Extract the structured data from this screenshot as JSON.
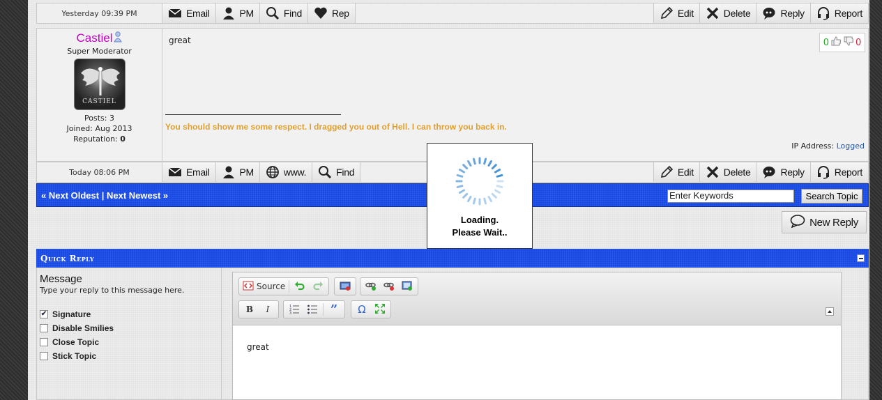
{
  "post1": {
    "date": "Yesterday 09:39 PM",
    "left_buttons": [
      {
        "label": "Email",
        "icon": "envelope-icon"
      },
      {
        "label": "PM",
        "icon": "user-icon"
      },
      {
        "label": "Find",
        "icon": "magnifier-icon"
      },
      {
        "label": "Rep",
        "icon": "heart-icon"
      }
    ],
    "right_buttons": [
      {
        "label": "Edit",
        "icon": "pencil-icon"
      },
      {
        "label": "Delete",
        "icon": "x-icon"
      },
      {
        "label": "Reply",
        "icon": "speech-bubble-icon"
      },
      {
        "label": "Report",
        "icon": "headset-icon"
      }
    ]
  },
  "post2": {
    "author": {
      "name": "Castiel",
      "rank": "Super Moderator",
      "avatar_text": "CASTIEL",
      "posts": "Posts: 3",
      "joined": "Joined: Aug 2013",
      "reputation_label": "Reputation:",
      "reputation_value": "0"
    },
    "message": "great",
    "signature": "You should show me some respect. I dragged you out of Hell. I can throw you back in.",
    "votes_up": "0",
    "votes_down": "0",
    "ip_label": "IP Address:",
    "ip_value": "Logged",
    "date": "Today 08:06 PM",
    "left_buttons": [
      {
        "label": "Email",
        "icon": "envelope-icon"
      },
      {
        "label": "PM",
        "icon": "user-icon"
      },
      {
        "label": "www.",
        "icon": "globe-icon"
      },
      {
        "label": "Find",
        "icon": "magnifier-icon"
      }
    ],
    "right_buttons": [
      {
        "label": "Edit",
        "icon": "pencil-icon"
      },
      {
        "label": "Delete",
        "icon": "x-icon"
      },
      {
        "label": "Reply",
        "icon": "speech-bubble-icon"
      },
      {
        "label": "Report",
        "icon": "headset-icon"
      }
    ]
  },
  "nav": {
    "next_oldest": "« Next Oldest",
    "separator": "|",
    "next_newest": "Next Newest »",
    "search_value": "Enter Keywords",
    "search_button": "Search Topic"
  },
  "new_reply": "New Reply",
  "quick_reply": {
    "title": "Quick Reply",
    "message_label": "Message",
    "message_desc": "Type your reply to this message here.",
    "options": [
      {
        "label": "Signature",
        "checked": true
      },
      {
        "label": "Disable Smilies",
        "checked": false
      },
      {
        "label": "Close Topic",
        "checked": false
      },
      {
        "label": "Stick Topic",
        "checked": false
      }
    ],
    "source_label": "Source",
    "editor_text": "great"
  },
  "loading": {
    "line1": "Loading.",
    "line2": "Please Wait.."
  },
  "colors": {
    "username": "#cc00cc",
    "signature": "#e0a030",
    "bar_blue": "#1a49e0",
    "vote_up": "#22aa22",
    "vote_down": "#cc2233"
  }
}
